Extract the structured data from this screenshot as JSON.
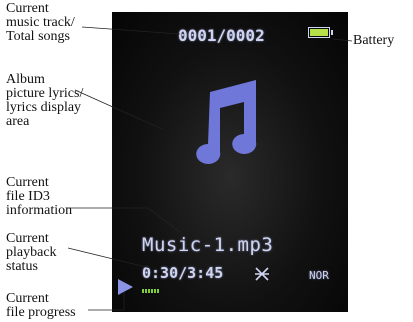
{
  "callouts": {
    "track": "Current\nmusic track/\nTotal songs",
    "battery": "Battery",
    "album": "Album\npicture lyrics/\nlyrics display\narea",
    "id3": "Current\nfile ID3\ninformation",
    "playback": "Current\nplayback\nstatus",
    "progress": "Current\nfile progress"
  },
  "screen": {
    "track_counter": "0001/0002",
    "filename": "Music-1.mp3",
    "elapsed": "0:30",
    "total": "3:45",
    "separator": "/",
    "eq_mode": "NOR",
    "battery_icon": "battery-icon",
    "music_note_icon": "music-note-icon",
    "play_icon": "play-icon",
    "repeat_icon": "repeat-mode-icon"
  },
  "colors": {
    "lcd_text": "#cfd4f0",
    "music_note": "#6f78d8",
    "battery_fill": "#b6e04a",
    "progress_fill": "#7ecf3a",
    "play_icon": "#8a93e6"
  },
  "progress_fraction": 0.13
}
